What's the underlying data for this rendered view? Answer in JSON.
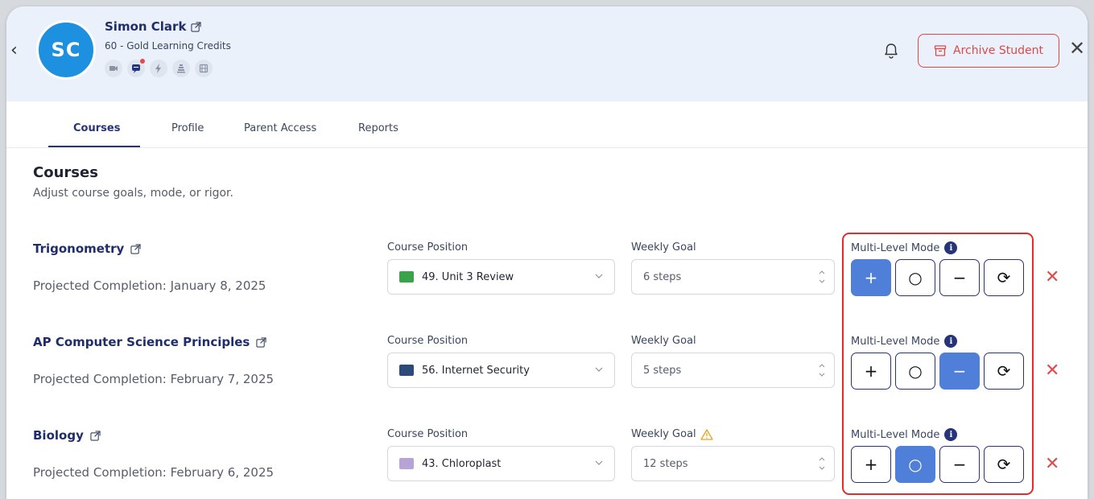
{
  "student": {
    "initials": "SC",
    "name": "Simon Clark",
    "credits": "60 - Gold Learning Credits",
    "icons": [
      "video-icon",
      "chat-icon",
      "bolt-icon",
      "stack-icon",
      "film-icon"
    ]
  },
  "header": {
    "archive_label": "Archive Student",
    "close_glyph": "✕",
    "back_glyph": "‹"
  },
  "tabs": [
    {
      "label": "Courses",
      "active": true
    },
    {
      "label": "Profile",
      "active": false
    },
    {
      "label": "Parent Access",
      "active": false
    },
    {
      "label": "Reports",
      "active": false
    }
  ],
  "section": {
    "title": "Courses",
    "subtitle": "Adjust course goals, mode, or rigor."
  },
  "labels": {
    "course_position": "Course Position",
    "weekly_goal": "Weekly Goal",
    "multi_level_mode": "Multi-Level Mode",
    "info": "i"
  },
  "mode_buttons": [
    "+",
    "○",
    "−",
    "⟳"
  ],
  "courses": [
    {
      "name": "Trigonometry",
      "projected": "Projected Completion: January 8, 2025",
      "position": "49. Unit 3 Review",
      "thumb_color": "#3aa34a",
      "goal": "6  steps",
      "warning": false,
      "selected_mode": 0
    },
    {
      "name": "AP Computer Science Principles",
      "projected": "Projected Completion: February 7, 2025",
      "position": "56. Internet Security",
      "thumb_color": "#2b4a7a",
      "goal": "5  steps",
      "warning": false,
      "selected_mode": 2
    },
    {
      "name": "Biology",
      "projected": "Projected Completion: February 6, 2025",
      "position": "43. Chloroplast",
      "thumb_color": "#b7a4d6",
      "goal": "12 steps",
      "warning": true,
      "selected_mode": 1
    }
  ],
  "colors": {
    "accent": "#26357a",
    "selected": "#4f7fd8",
    "danger": "#e04848",
    "warning": "#f0a020"
  }
}
